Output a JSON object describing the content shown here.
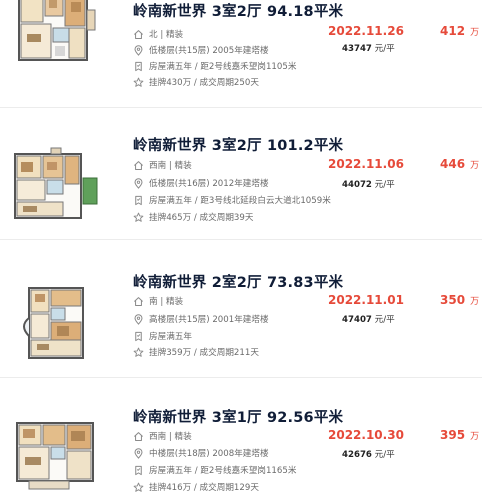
{
  "listings": [
    {
      "title": "岭南新世界 3室2厅 94.18平米",
      "orientation": "北 | 精装",
      "floor": "低楼层(共15层) 2005年建塔楼",
      "tags": "房屋满五年 / 距2号线嘉禾望岗1105米",
      "listing_info": "挂牌430万 / 成交周期250天",
      "deal_date": "2022.11.26",
      "unit_price": "43747",
      "unit_price_suffix": "元/平",
      "total_price": "412",
      "total_unit": "万"
    },
    {
      "title": "岭南新世界 3室2厅 101.2平米",
      "orientation": "西南 | 精装",
      "floor": "低楼层(共16层) 2012年建塔楼",
      "tags": "房屋满五年 / 距3号线北延段白云大道北1059米",
      "listing_info": "挂牌465万 / 成交周期39天",
      "deal_date": "2022.11.06",
      "unit_price": "44072",
      "unit_price_suffix": "元/平",
      "total_price": "446",
      "total_unit": "万"
    },
    {
      "title": "岭南新世界 2室2厅 73.83平米",
      "orientation": "南 | 精装",
      "floor": "高楼层(共15层) 2001年建塔楼",
      "tags": "房屋满五年",
      "listing_info": "挂牌359万 / 成交周期211天",
      "deal_date": "2022.11.01",
      "unit_price": "47407",
      "unit_price_suffix": "元/平",
      "total_price": "350",
      "total_unit": "万"
    },
    {
      "title": "岭南新世界 3室1厅 92.56平米",
      "orientation": "西南 | 精装",
      "floor": "中楼层(共18层) 2008年建塔楼",
      "tags": "房屋满五年 / 距2号线嘉禾望岗1165米",
      "listing_info": "挂牌416万 / 成交周期129天",
      "deal_date": "2022.10.30",
      "unit_price": "42676",
      "unit_price_suffix": "元/平",
      "total_price": "395",
      "total_unit": "万"
    }
  ],
  "icons": {
    "orientation": "house-icon",
    "floor": "location-pin-icon",
    "tags": "tag-icon",
    "listing_info": "star-icon"
  },
  "colors": {
    "title": "#101d37",
    "price_accent": "#e64a3a",
    "meta_text": "#6b6b6b"
  }
}
